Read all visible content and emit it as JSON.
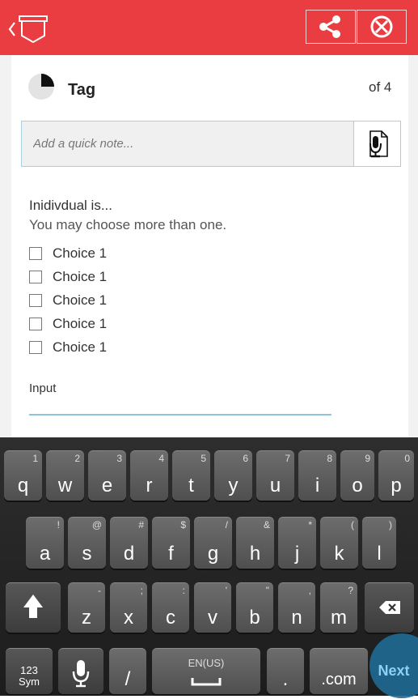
{
  "header": {
    "back_icon": "back-chevron-icon",
    "logo_icon": "app-logo-icon",
    "share_icon": "share-icon",
    "close_icon": "close-circle-icon",
    "accent": "#ea3d42"
  },
  "form": {
    "title": "Tag",
    "page_of": "of 4",
    "progress_fraction": 0.25,
    "note_placeholder": "Add a quick note...",
    "mic_icon": "microphone-note-icon",
    "question": "Inidivdual is...",
    "hint": "You may choose more than one.",
    "choices": [
      "Choice 1",
      "Choice 1",
      "Choice 1",
      "Choice 1",
      "Choice 1"
    ],
    "input_label": "Input"
  },
  "keyboard": {
    "row1": [
      {
        "main": "q",
        "sub": "1"
      },
      {
        "main": "w",
        "sub": "2"
      },
      {
        "main": "e",
        "sub": "3"
      },
      {
        "main": "r",
        "sub": "4"
      },
      {
        "main": "t",
        "sub": "5"
      },
      {
        "main": "y",
        "sub": "6"
      },
      {
        "main": "u",
        "sub": "7"
      },
      {
        "main": "i",
        "sub": "8"
      },
      {
        "main": "o",
        "sub": "9"
      },
      {
        "main": "p",
        "sub": "0"
      }
    ],
    "row2": [
      {
        "main": "a",
        "sub": "!"
      },
      {
        "main": "s",
        "sub": "@"
      },
      {
        "main": "d",
        "sub": "#"
      },
      {
        "main": "f",
        "sub": "$"
      },
      {
        "main": "g",
        "sub": "/"
      },
      {
        "main": "h",
        "sub": "&"
      },
      {
        "main": "j",
        "sub": "*"
      },
      {
        "main": "k",
        "sub": "("
      },
      {
        "main": "l",
        "sub": ")"
      }
    ],
    "row3": [
      {
        "main": "z",
        "sub": "-"
      },
      {
        "main": "x",
        "sub": ";"
      },
      {
        "main": "c",
        "sub": ":"
      },
      {
        "main": "v",
        "sub": "'"
      },
      {
        "main": "b",
        "sub": "\""
      },
      {
        "main": "n",
        "sub": ","
      },
      {
        "main": "m",
        "sub": "?"
      }
    ],
    "sym_label_1": "123",
    "sym_label_2": "Sym",
    "slash": "/",
    "lang": "EN(US)",
    "period": ".",
    "dotcom": ".com",
    "next": "Next",
    "shift_icon": "shift-arrow-icon",
    "backspace_icon": "backspace-icon",
    "mic_icon": "microphone-icon"
  }
}
